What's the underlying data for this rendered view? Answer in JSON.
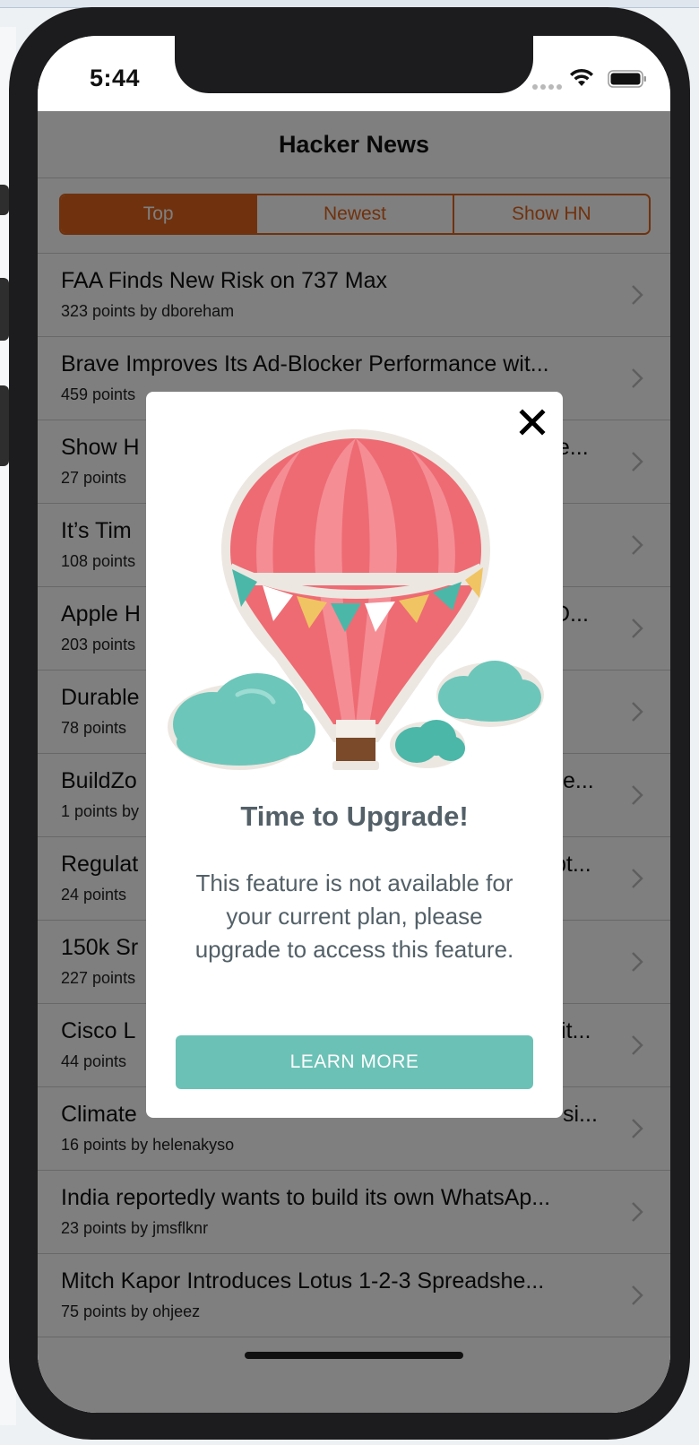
{
  "status_bar": {
    "time": "5:44"
  },
  "app": {
    "title": "Hacker News",
    "tabs": [
      {
        "label": "Top",
        "active": true
      },
      {
        "label": "Newest",
        "active": false
      },
      {
        "label": "Show HN",
        "active": false
      }
    ],
    "stories": [
      {
        "title": "FAA Finds New Risk on 737 Max",
        "subtitle": "323 points by dboreham"
      },
      {
        "title": "Brave Improves Its Ad-Blocker Performance wit...",
        "subtitle": "459 points"
      },
      {
        "title": "Show H",
        "title_end": "pe...",
        "subtitle": "27 points"
      },
      {
        "title": "It’s Tim",
        "subtitle": "108 points"
      },
      {
        "title": "Apple H",
        "title_end": "D...",
        "subtitle": "203 points"
      },
      {
        "title": "Durable",
        "subtitle": "78 points"
      },
      {
        "title": "BuildZo",
        "title_end": "e...",
        "subtitle": "1 points by"
      },
      {
        "title": "Regulat",
        "title_end": "pt...",
        "subtitle": "24 points"
      },
      {
        "title": "150k Sr",
        "subtitle": "227 points"
      },
      {
        "title": "Cisco L",
        "title_end": "wit...",
        "subtitle": "44 points"
      },
      {
        "title": "Climate",
        "title_end": "si...",
        "subtitle": "16 points by helenakyso"
      },
      {
        "title": "India reportedly wants to build its own WhatsAp...",
        "subtitle": "23 points by jmsflknr"
      },
      {
        "title": "Mitch Kapor Introduces Lotus 1-2-3 Spreadshe...",
        "subtitle": "75 points by ohjeez"
      }
    ]
  },
  "modal": {
    "title": "Time to Upgrade!",
    "body": "This feature is not available for your current plan, please upgrade to access this feature.",
    "button": "LEARN MORE",
    "illustration": "hot-air-balloon-with-clouds",
    "accent_color": "#6cc1b6"
  },
  "colors": {
    "segment_accent": "#e0641c",
    "modal_text": "#536068"
  }
}
